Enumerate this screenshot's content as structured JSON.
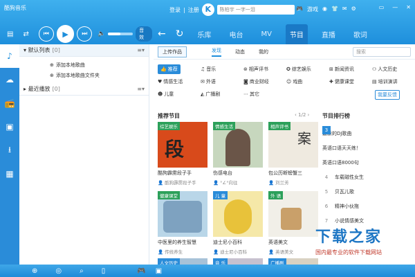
{
  "app": {
    "title": "酷狗音乐",
    "login": "登录",
    "register": "注册",
    "logo": "K",
    "search_placeholder": "陈柏宇 一字一泪",
    "game_label": "游戏"
  },
  "player": {
    "sound_effect_label": "音效",
    "volume_percent": 50
  },
  "nav": {
    "tabs": [
      {
        "label": "乐库",
        "active": false
      },
      {
        "label": "电台",
        "active": false
      },
      {
        "label": "MV",
        "active": false
      },
      {
        "label": "节目",
        "active": true
      },
      {
        "label": "直播",
        "active": false
      },
      {
        "label": "歌词",
        "active": false
      }
    ]
  },
  "sidebar": {
    "icons": [
      "music-note-icon",
      "cloud-icon",
      "radio-icon",
      "recent-icon",
      "download-icon",
      "apps-icon"
    ]
  },
  "playlist": {
    "default_list": {
      "label": "默认列表",
      "count": "[0]"
    },
    "add_song": "添加本地歌曲",
    "add_folder": "添加本地歌曲文件夹",
    "recent": {
      "label": "最近播放",
      "count": "[0]"
    }
  },
  "content": {
    "upload_label": "上传作品",
    "subtabs": [
      {
        "label": "发现",
        "active": true
      },
      {
        "label": "动态",
        "active": false
      },
      {
        "label": "我的",
        "active": false
      }
    ],
    "search_placeholder": "搜索",
    "categories": [
      "推荐",
      "音乐",
      "相声评书",
      "综艺娱乐",
      "新闻资讯",
      "人文历史",
      "情感生活",
      "外语",
      "商业财经",
      "戏曲",
      "健康课堂",
      "培训演讲",
      "儿童",
      "广播剧",
      "其它"
    ],
    "feedback_label": "我要反馈",
    "recommend_title": "推荐节目",
    "pager": "1/2",
    "rank_title": "节目排行榜"
  },
  "recommend_cards": [
    {
      "tag": "综艺娱乐",
      "title": "酷狗霹雳段子手",
      "sub": "酷狗霹雳段子手",
      "color": "#d84a1b",
      "tag_color": "#2ca05a"
    },
    {
      "tag": "情感生活",
      "title": "伤感电台",
      "sub": "°∠°向往",
      "color": "#c7d7be",
      "tag_color": "#2ca05a"
    },
    {
      "tag": "相声评书",
      "title": "包公历断螃蟹三",
      "sub": "刘兰芳",
      "color": "#efeae0",
      "tag_color": "#2ca05a"
    },
    {
      "tag": "健康课堂",
      "title": "中医里的养生智慧",
      "sub": "传统养生",
      "color": "#b9d6e8",
      "tag_color": "#2ca05a"
    },
    {
      "tag": "儿 童",
      "title": "迪士尼小百科",
      "sub": "迪士尼小百科",
      "color": "#f5e8a8",
      "tag_color": "#2a8cd9"
    },
    {
      "tag": "外 语",
      "title": "英语美文",
      "sub": "英语美文",
      "color": "#f1efe8",
      "tag_color": "#2ca05a"
    },
    {
      "tag": "人文历史",
      "color": "#a7c2d8",
      "tag_color": "#2a8cd9"
    },
    {
      "tag": "音 乐",
      "color": "#c7c1cf",
      "tag_color": "#2a8cd9"
    },
    {
      "tag": "广播剧",
      "color": "#d9d2c2",
      "tag_color": "#2a8cd9"
    }
  ],
  "rankings": [
    {
      "rank": "1",
      "title": "最新的DJ歌曲"
    },
    {
      "rank": "2",
      "title": "英语口语天天练！"
    },
    {
      "rank": "3",
      "title": "英语口语8000句"
    },
    {
      "rank": "4",
      "title": "车载磁性女生"
    },
    {
      "rank": "5",
      "title": "贝瓦儿歌"
    },
    {
      "rank": "6",
      "title": "精神小伙拖"
    },
    {
      "rank": "7",
      "title": "小说情感美文"
    }
  ],
  "watermark": {
    "big": "下载之家",
    "small": "国内最专业的软件下载网站"
  }
}
